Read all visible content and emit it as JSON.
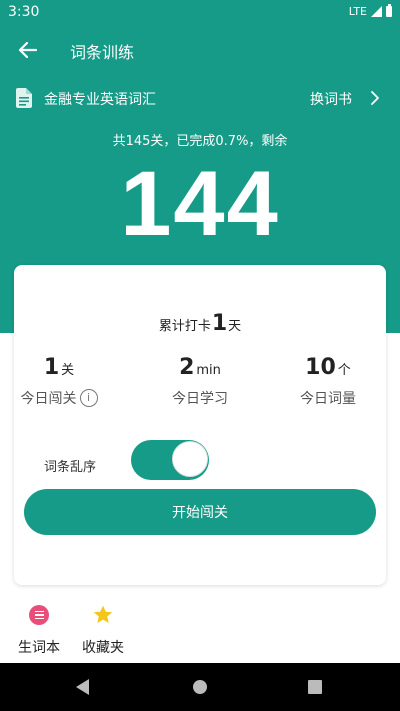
{
  "status_bar": {
    "time": "3:30",
    "network": "LTE"
  },
  "appbar": {
    "title": "词条训练",
    "back_icon": "arrow-left-icon"
  },
  "book": {
    "name": "金融专业英语词汇",
    "change_label": "换词书",
    "doc_icon": "document-icon",
    "chevron_icon": "chevron-right-icon"
  },
  "progress": {
    "summary": "共145关，已完成0.7%，剩余",
    "remaining": "144"
  },
  "card": {
    "checkin": {
      "prefix": "累计打卡",
      "days": "1",
      "suffix": "天"
    },
    "stats": [
      {
        "value": "1",
        "unit": "关",
        "label": "今日闯关"
      },
      {
        "value": "2",
        "unit": "min",
        "label": "今日学习"
      },
      {
        "value": "10",
        "unit": "个",
        "label": "今日词量"
      }
    ],
    "info_icon_glyph": "i",
    "shuffle_label": "词条乱序",
    "shuffle_on": true,
    "start_button": "开始闯关"
  },
  "tools": [
    {
      "label": "生词本",
      "icon": "vocab-list-icon"
    },
    {
      "label": "收藏夹",
      "icon": "star-icon"
    }
  ],
  "colors": {
    "primary": "#159b87",
    "pink": "#e94e7b",
    "star": "#f5c518"
  }
}
